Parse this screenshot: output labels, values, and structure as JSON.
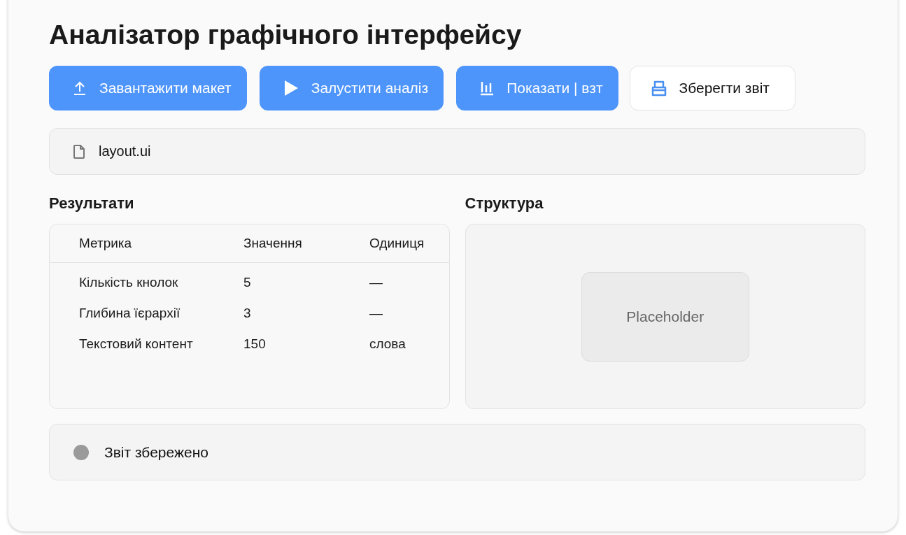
{
  "title": "Аналізатор графічного інтерфейсу",
  "buttons": [
    {
      "label": "Завантажити макет",
      "kind": "primary"
    },
    {
      "label": "Залустити аналіз",
      "kind": "primary"
    },
    {
      "label": "Показати | взт",
      "kind": "primary"
    },
    {
      "label": "Зберегти звіт",
      "kind": "secondary"
    }
  ],
  "file": {
    "name": "layout.ui"
  },
  "results": {
    "heading": "Результати",
    "columns": [
      "Метрика",
      "Значення",
      "Одиниця"
    ],
    "rows": [
      [
        "Кількість кнолок",
        "5",
        "—"
      ],
      [
        "Глибина їєрархії",
        "3",
        "—"
      ],
      [
        "Текстовий контент",
        "150",
        "слова"
      ]
    ]
  },
  "structure": {
    "heading": "Структура",
    "placeholder": "Placeholder"
  },
  "status": {
    "text": "Звіт збережено"
  }
}
